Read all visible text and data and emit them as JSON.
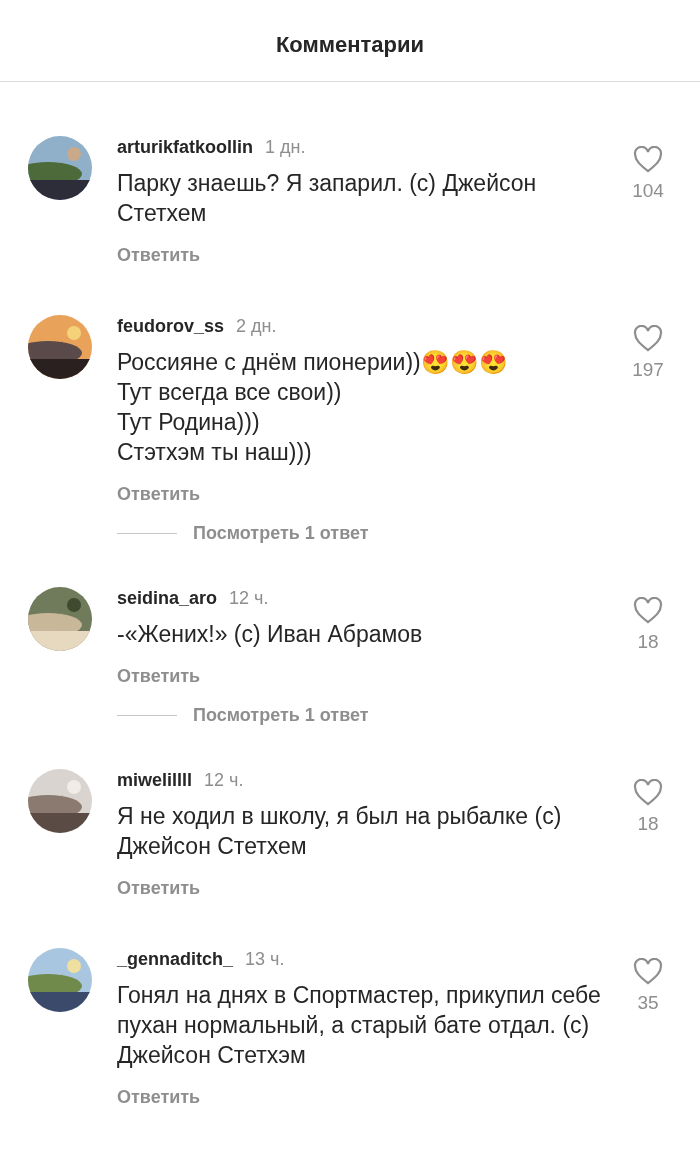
{
  "header": {
    "title": "Комментарии"
  },
  "comments": [
    {
      "username": "arturikfatkoollin",
      "time": "1 дн.",
      "lines": [
        "Парку знаешь? Я запарил. (с) Джейсон Стетхем"
      ],
      "likes": "104",
      "liked": false,
      "reply": "Ответить",
      "avatar": {
        "kind": "picture"
      }
    },
    {
      "username": "feudorov_ss",
      "time": "2 дн.",
      "lines": [
        "Россияне с днём пионерии))😍😍😍",
        "Тут всегда все свои))",
        "Тут Родина)))",
        "Стэтхэм ты наш)))"
      ],
      "likes": "197",
      "liked": false,
      "reply": "Ответить",
      "avatar": {
        "kind": "picture"
      },
      "view_replies": "Посмотреть 1 ответ"
    },
    {
      "username": "seidina_aro",
      "time": "12 ч.",
      "lines": [
        "-«Жених!» (с) Иван Абрамов"
      ],
      "likes": "18",
      "liked": false,
      "reply": "Ответить",
      "avatar": {
        "kind": "picture"
      },
      "view_replies": "Посмотреть 1 ответ"
    },
    {
      "username": "miwelillll",
      "time": "12 ч.",
      "lines": [
        "Я не ходил в школу, я был на рыбалке (с) Джейсон Стетхем"
      ],
      "likes": "18",
      "liked": false,
      "reply": "Ответить",
      "avatar": {
        "kind": "picture"
      }
    },
    {
      "username": "_gennaditch_",
      "time": "13 ч.",
      "lines": [
        "Гонял на днях в Спортмастер, прикупил себе пухан нормальный, а старый бате отдал. (с) Джейсон Стетхэм"
      ],
      "likes": "35",
      "liked": false,
      "reply": "Ответить",
      "avatar": {
        "kind": "picture"
      }
    }
  ]
}
